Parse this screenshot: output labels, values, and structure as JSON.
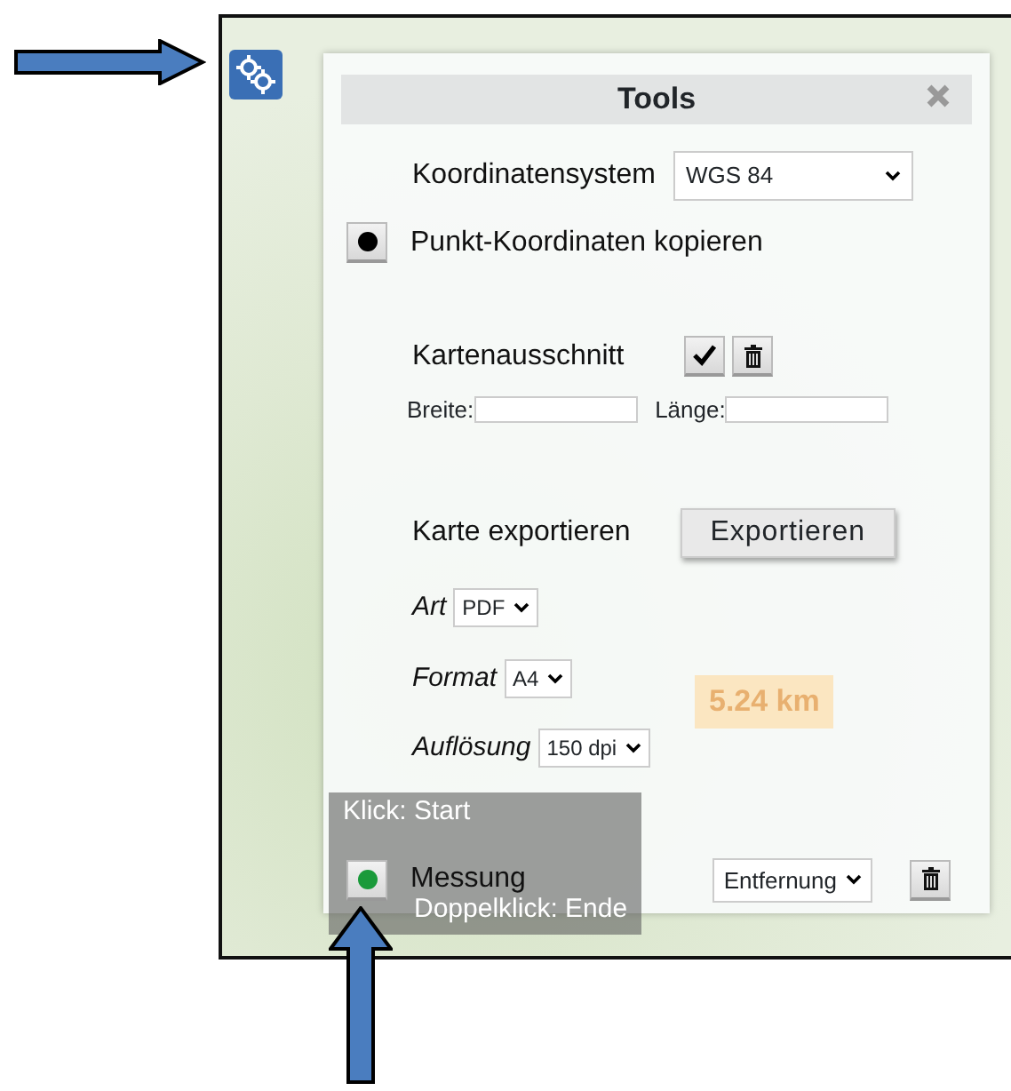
{
  "panel": {
    "title": "Tools",
    "coordinate_system": {
      "label": "Koordinatensystem",
      "value": "WGS 84"
    },
    "copy_point": {
      "label": "Punkt-Koordinaten kopieren",
      "active": false
    },
    "map_extent": {
      "label": "Kartenausschnitt",
      "width_label": "Breite:",
      "length_label": "Länge:"
    },
    "export": {
      "label": "Karte exportieren",
      "button": "Exportieren",
      "options": [
        {
          "label": "Art",
          "value": "PDF"
        },
        {
          "label": "Format",
          "value": "A4"
        },
        {
          "label": "Auflösung",
          "value": "150 dpi"
        }
      ]
    },
    "measure": {
      "label": "Messung",
      "active": true,
      "mode": "Entfernung"
    }
  },
  "map_overlays": {
    "distance_label": "5.24 km",
    "tooltip": [
      "Klick: Start",
      "Doppelklick: Ende"
    ]
  }
}
